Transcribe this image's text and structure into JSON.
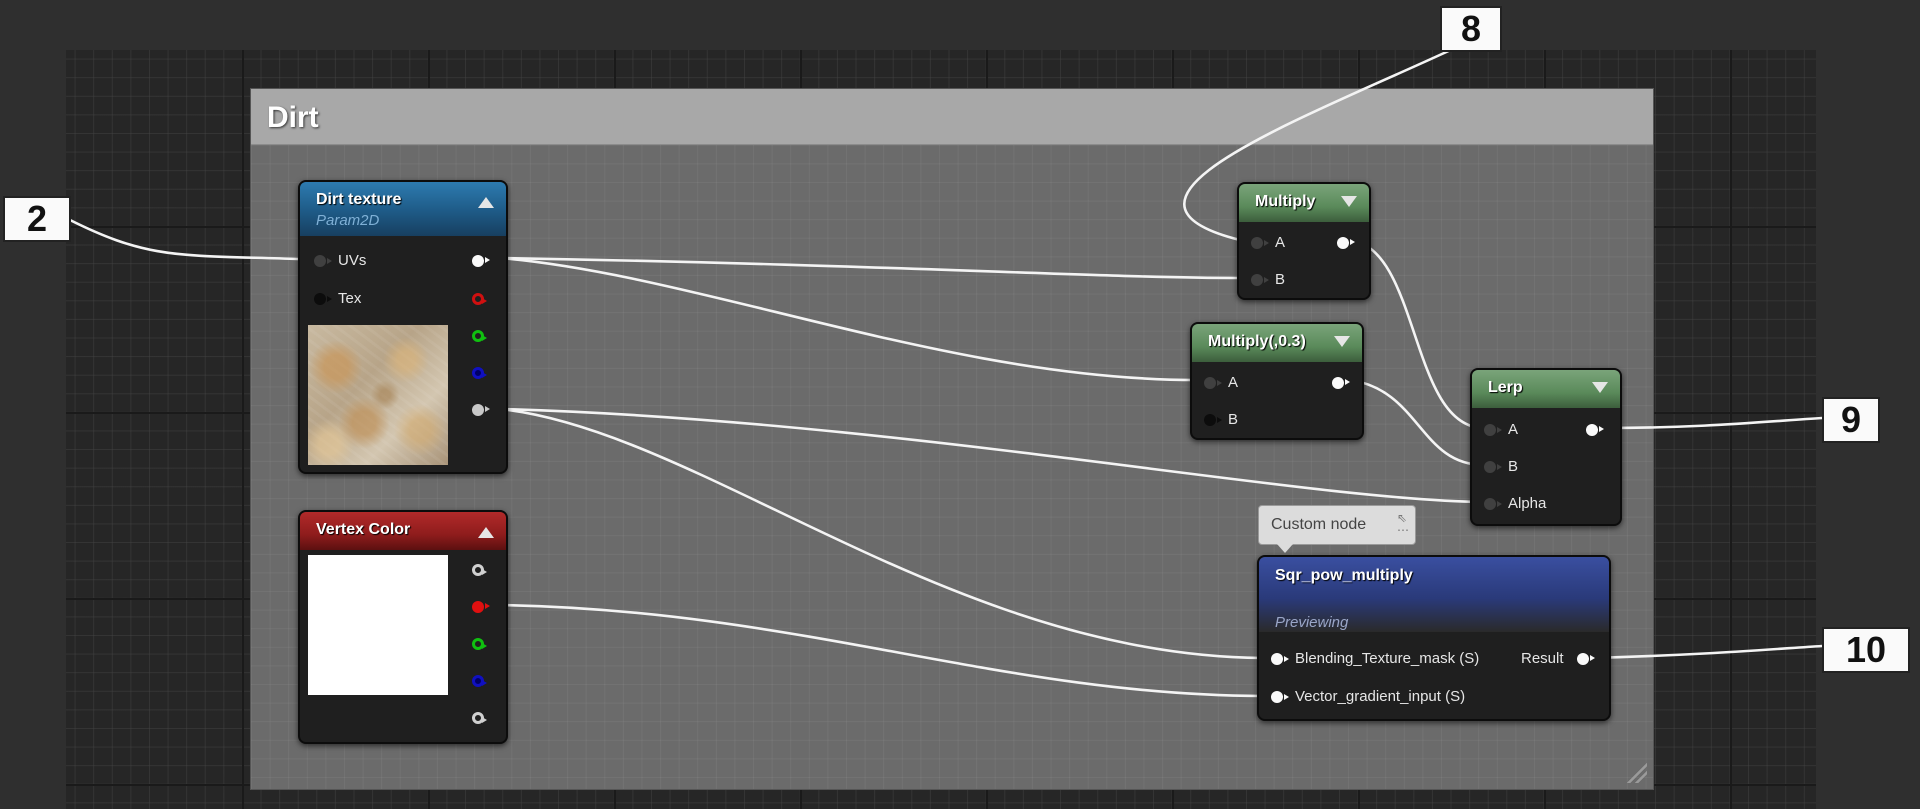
{
  "comment": {
    "title": "Dirt"
  },
  "nodes": {
    "dirt_texture": {
      "title": "Dirt texture",
      "subtitle": "Param2D",
      "inputs": [
        "UVs",
        "Tex"
      ]
    },
    "vertex_color": {
      "title": "Vertex Color"
    },
    "multiply": {
      "title": "Multiply",
      "inputs": [
        "A",
        "B"
      ]
    },
    "multiply_03": {
      "title": "Multiply(,0.3)",
      "inputs": [
        "A",
        "B"
      ]
    },
    "lerp": {
      "title": "Lerp",
      "inputs": [
        "A",
        "B",
        "Alpha"
      ]
    },
    "custom": {
      "title": "Sqr_pow_multiply",
      "subtitle": "Previewing",
      "inputs": [
        "Blending_Texture_mask (S)",
        "Vector_gradient_input (S)"
      ],
      "output": "Result"
    }
  },
  "tooltip": {
    "text": "Custom node"
  },
  "callouts": {
    "c2": "2",
    "c8": "8",
    "c9": "9",
    "c10": "10"
  },
  "colors": {
    "header_blue": "#1e5a86",
    "header_red": "#8e1c1c",
    "header_green": "#5a8a5a",
    "header_custom": "#2a3a7a"
  }
}
